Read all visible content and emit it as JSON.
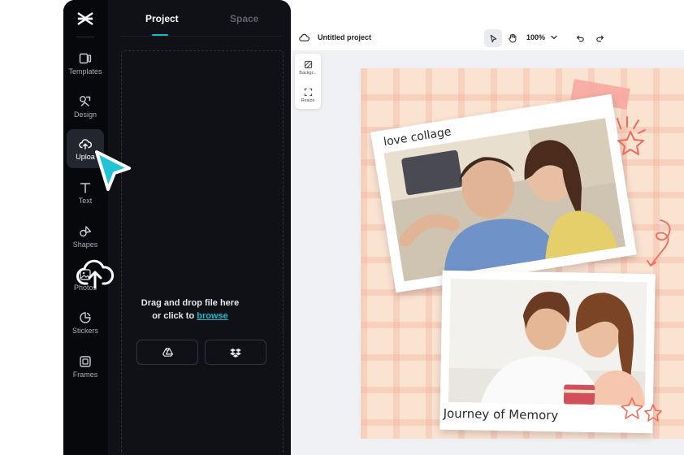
{
  "rail": {
    "items": [
      {
        "label": "Templates",
        "icon": "templates-icon"
      },
      {
        "label": "Design",
        "icon": "design-icon"
      },
      {
        "label": "Uploa",
        "icon": "upload-icon"
      },
      {
        "label": "Text",
        "icon": "text-icon"
      },
      {
        "label": "Shapes",
        "icon": "shapes-icon"
      },
      {
        "label": "Photos",
        "icon": "photos-icon"
      },
      {
        "label": "Stickers",
        "icon": "stickers-icon"
      },
      {
        "label": "Frames",
        "icon": "frames-icon"
      }
    ],
    "active": "Uploa"
  },
  "panel": {
    "tabs": [
      {
        "label": "Project"
      },
      {
        "label": "Space"
      }
    ],
    "active_tab": "Project",
    "drop_text_1": "Drag and drop file here",
    "drop_text_2_prefix": "or click to",
    "browse_label": "browse",
    "sources": [
      "google-drive-icon",
      "dropbox-icon"
    ]
  },
  "topbar": {
    "project_title": "Untitled project",
    "zoom": "100%"
  },
  "mini_tools": [
    {
      "label": "Backgr...",
      "icon": "background-icon"
    },
    {
      "label": "Resize",
      "icon": "resize-icon"
    }
  ],
  "design": {
    "caption_top": "love collage",
    "caption_bottom": "Journey of Memory"
  },
  "colors": {
    "accent": "#1fb7c9",
    "shell": "#101116",
    "rail": "#07080b",
    "design_bg": "#fbe3d2"
  }
}
